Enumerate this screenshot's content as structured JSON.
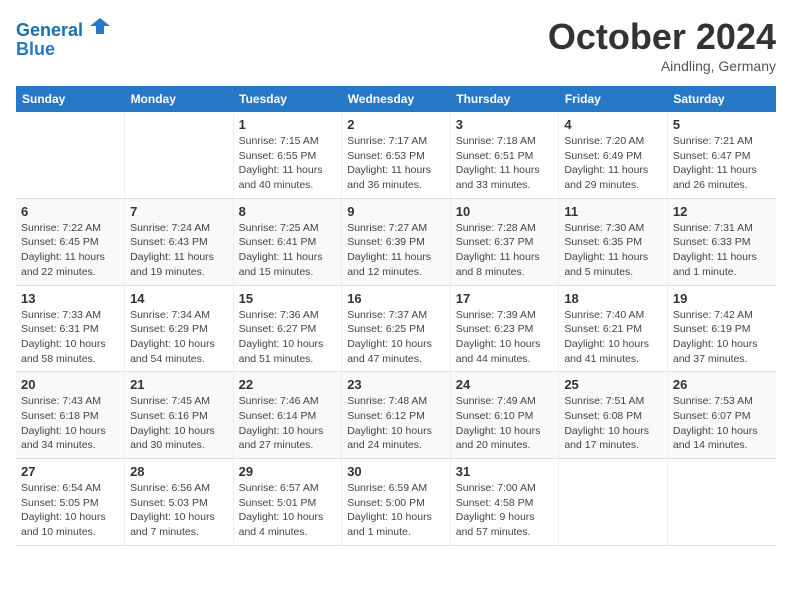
{
  "header": {
    "logo_line1": "General",
    "logo_line2": "Blue",
    "month": "October 2024",
    "location": "Aindling, Germany"
  },
  "days_of_week": [
    "Sunday",
    "Monday",
    "Tuesday",
    "Wednesday",
    "Thursday",
    "Friday",
    "Saturday"
  ],
  "weeks": [
    [
      {
        "day": "",
        "empty": true
      },
      {
        "day": "",
        "empty": true
      },
      {
        "day": "1",
        "sunrise": "Sunrise: 7:15 AM",
        "sunset": "Sunset: 6:55 PM",
        "daylight": "Daylight: 11 hours and 40 minutes."
      },
      {
        "day": "2",
        "sunrise": "Sunrise: 7:17 AM",
        "sunset": "Sunset: 6:53 PM",
        "daylight": "Daylight: 11 hours and 36 minutes."
      },
      {
        "day": "3",
        "sunrise": "Sunrise: 7:18 AM",
        "sunset": "Sunset: 6:51 PM",
        "daylight": "Daylight: 11 hours and 33 minutes."
      },
      {
        "day": "4",
        "sunrise": "Sunrise: 7:20 AM",
        "sunset": "Sunset: 6:49 PM",
        "daylight": "Daylight: 11 hours and 29 minutes."
      },
      {
        "day": "5",
        "sunrise": "Sunrise: 7:21 AM",
        "sunset": "Sunset: 6:47 PM",
        "daylight": "Daylight: 11 hours and 26 minutes."
      }
    ],
    [
      {
        "day": "6",
        "sunrise": "Sunrise: 7:22 AM",
        "sunset": "Sunset: 6:45 PM",
        "daylight": "Daylight: 11 hours and 22 minutes."
      },
      {
        "day": "7",
        "sunrise": "Sunrise: 7:24 AM",
        "sunset": "Sunset: 6:43 PM",
        "daylight": "Daylight: 11 hours and 19 minutes."
      },
      {
        "day": "8",
        "sunrise": "Sunrise: 7:25 AM",
        "sunset": "Sunset: 6:41 PM",
        "daylight": "Daylight: 11 hours and 15 minutes."
      },
      {
        "day": "9",
        "sunrise": "Sunrise: 7:27 AM",
        "sunset": "Sunset: 6:39 PM",
        "daylight": "Daylight: 11 hours and 12 minutes."
      },
      {
        "day": "10",
        "sunrise": "Sunrise: 7:28 AM",
        "sunset": "Sunset: 6:37 PM",
        "daylight": "Daylight: 11 hours and 8 minutes."
      },
      {
        "day": "11",
        "sunrise": "Sunrise: 7:30 AM",
        "sunset": "Sunset: 6:35 PM",
        "daylight": "Daylight: 11 hours and 5 minutes."
      },
      {
        "day": "12",
        "sunrise": "Sunrise: 7:31 AM",
        "sunset": "Sunset: 6:33 PM",
        "daylight": "Daylight: 11 hours and 1 minute."
      }
    ],
    [
      {
        "day": "13",
        "sunrise": "Sunrise: 7:33 AM",
        "sunset": "Sunset: 6:31 PM",
        "daylight": "Daylight: 10 hours and 58 minutes."
      },
      {
        "day": "14",
        "sunrise": "Sunrise: 7:34 AM",
        "sunset": "Sunset: 6:29 PM",
        "daylight": "Daylight: 10 hours and 54 minutes."
      },
      {
        "day": "15",
        "sunrise": "Sunrise: 7:36 AM",
        "sunset": "Sunset: 6:27 PM",
        "daylight": "Daylight: 10 hours and 51 minutes."
      },
      {
        "day": "16",
        "sunrise": "Sunrise: 7:37 AM",
        "sunset": "Sunset: 6:25 PM",
        "daylight": "Daylight: 10 hours and 47 minutes."
      },
      {
        "day": "17",
        "sunrise": "Sunrise: 7:39 AM",
        "sunset": "Sunset: 6:23 PM",
        "daylight": "Daylight: 10 hours and 44 minutes."
      },
      {
        "day": "18",
        "sunrise": "Sunrise: 7:40 AM",
        "sunset": "Sunset: 6:21 PM",
        "daylight": "Daylight: 10 hours and 41 minutes."
      },
      {
        "day": "19",
        "sunrise": "Sunrise: 7:42 AM",
        "sunset": "Sunset: 6:19 PM",
        "daylight": "Daylight: 10 hours and 37 minutes."
      }
    ],
    [
      {
        "day": "20",
        "sunrise": "Sunrise: 7:43 AM",
        "sunset": "Sunset: 6:18 PM",
        "daylight": "Daylight: 10 hours and 34 minutes."
      },
      {
        "day": "21",
        "sunrise": "Sunrise: 7:45 AM",
        "sunset": "Sunset: 6:16 PM",
        "daylight": "Daylight: 10 hours and 30 minutes."
      },
      {
        "day": "22",
        "sunrise": "Sunrise: 7:46 AM",
        "sunset": "Sunset: 6:14 PM",
        "daylight": "Daylight: 10 hours and 27 minutes."
      },
      {
        "day": "23",
        "sunrise": "Sunrise: 7:48 AM",
        "sunset": "Sunset: 6:12 PM",
        "daylight": "Daylight: 10 hours and 24 minutes."
      },
      {
        "day": "24",
        "sunrise": "Sunrise: 7:49 AM",
        "sunset": "Sunset: 6:10 PM",
        "daylight": "Daylight: 10 hours and 20 minutes."
      },
      {
        "day": "25",
        "sunrise": "Sunrise: 7:51 AM",
        "sunset": "Sunset: 6:08 PM",
        "daylight": "Daylight: 10 hours and 17 minutes."
      },
      {
        "day": "26",
        "sunrise": "Sunrise: 7:53 AM",
        "sunset": "Sunset: 6:07 PM",
        "daylight": "Daylight: 10 hours and 14 minutes."
      }
    ],
    [
      {
        "day": "27",
        "sunrise": "Sunrise: 6:54 AM",
        "sunset": "Sunset: 5:05 PM",
        "daylight": "Daylight: 10 hours and 10 minutes."
      },
      {
        "day": "28",
        "sunrise": "Sunrise: 6:56 AM",
        "sunset": "Sunset: 5:03 PM",
        "daylight": "Daylight: 10 hours and 7 minutes."
      },
      {
        "day": "29",
        "sunrise": "Sunrise: 6:57 AM",
        "sunset": "Sunset: 5:01 PM",
        "daylight": "Daylight: 10 hours and 4 minutes."
      },
      {
        "day": "30",
        "sunrise": "Sunrise: 6:59 AM",
        "sunset": "Sunset: 5:00 PM",
        "daylight": "Daylight: 10 hours and 1 minute."
      },
      {
        "day": "31",
        "sunrise": "Sunrise: 7:00 AM",
        "sunset": "Sunset: 4:58 PM",
        "daylight": "Daylight: 9 hours and 57 minutes."
      },
      {
        "day": "",
        "empty": true
      },
      {
        "day": "",
        "empty": true
      }
    ]
  ]
}
